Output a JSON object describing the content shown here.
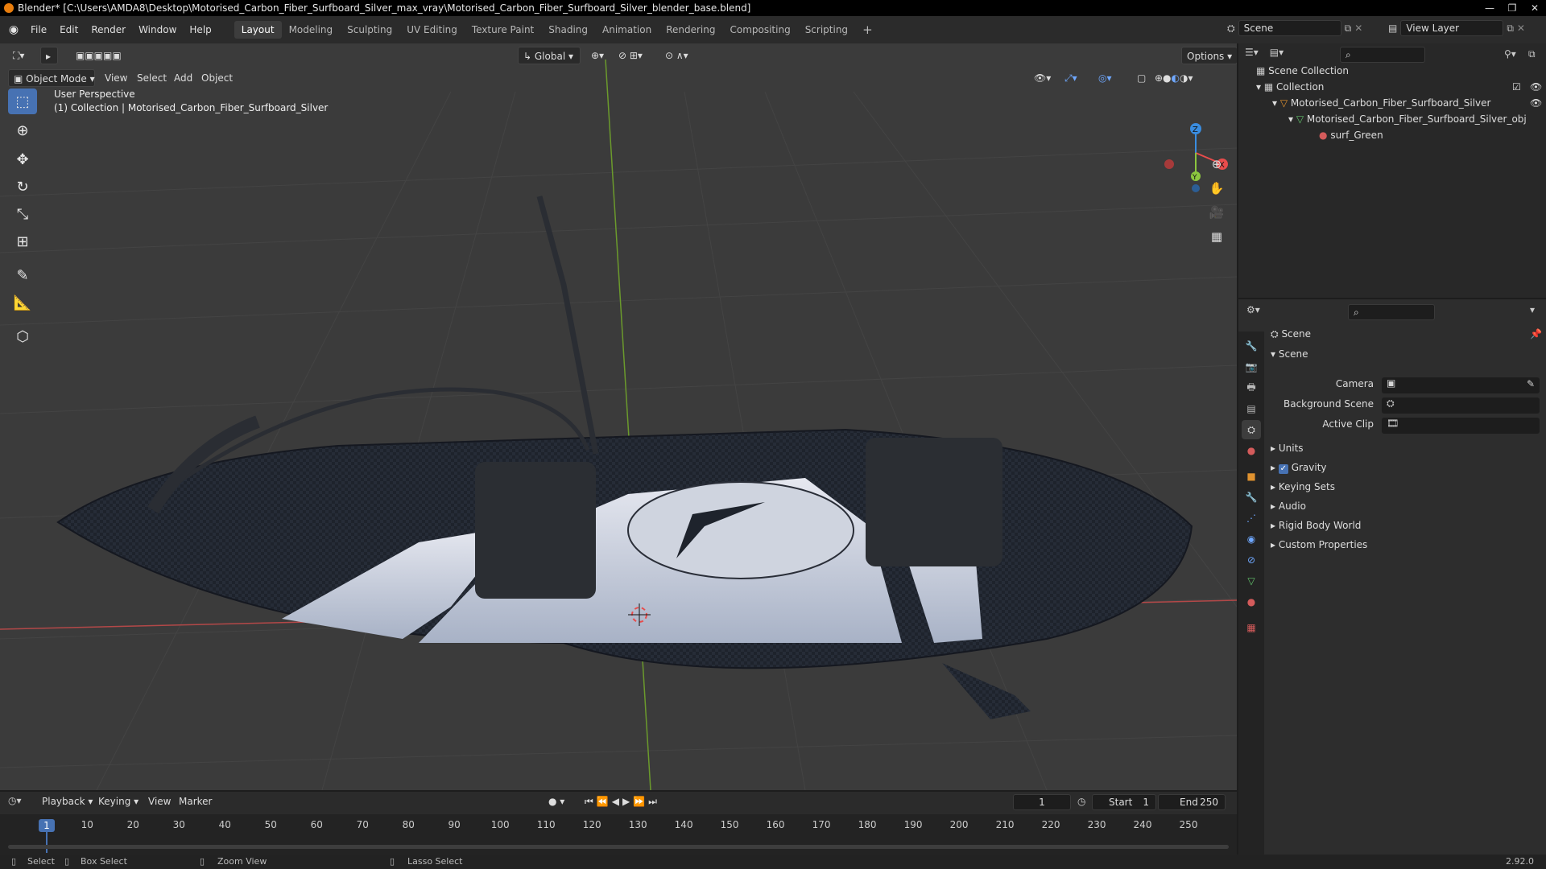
{
  "titlebar": {
    "title": "Blender* [C:\\Users\\AMDA8\\Desktop\\Motorised_Carbon_Fiber_Surfboard_Silver_max_vray\\Motorised_Carbon_Fiber_Surfboard_Silver_blender_base.blend]",
    "min": "—",
    "max": "❐",
    "close": "✕"
  },
  "menu": {
    "items": [
      "File",
      "Edit",
      "Render",
      "Window",
      "Help"
    ]
  },
  "workspaces": {
    "tabs": [
      "Layout",
      "Modeling",
      "Sculpting",
      "UV Editing",
      "Texture Paint",
      "Shading",
      "Animation",
      "Rendering",
      "Compositing",
      "Scripting"
    ],
    "active": "Layout",
    "add": "+"
  },
  "scene_selector": {
    "value": "Scene"
  },
  "view_layer_selector": {
    "value": "View Layer"
  },
  "viewport": {
    "mode": "Object Mode",
    "menus": [
      "View",
      "Select",
      "Add",
      "Object"
    ],
    "transform_orientation": "Global",
    "options": "Options",
    "perspective_label": "User Perspective",
    "collection_label": "(1) Collection | Motorised_Carbon_Fiber_Surfboard_Silver",
    "gizmo": {
      "x": "X",
      "y": "Y",
      "z": "Z"
    }
  },
  "outliner": {
    "root": "Scene Collection",
    "collection": "Collection",
    "object": "Motorised_Carbon_Fiber_Surfboard_Silver",
    "mesh": "Motorised_Carbon_Fiber_Surfboard_Silver_obj",
    "material": "surf_Green"
  },
  "properties": {
    "header": "Scene",
    "section": "Scene",
    "camera_label": "Camera",
    "background_scene_label": "Background Scene",
    "active_clip_label": "Active Clip",
    "panels": [
      "Units",
      "Gravity",
      "Keying Sets",
      "Audio",
      "Rigid Body World",
      "Custom Properties"
    ],
    "gravity_checked": true
  },
  "timeline": {
    "menus": [
      "Playback",
      "Keying",
      "View",
      "Marker"
    ],
    "current_frame": "1",
    "start_label": "Start",
    "start": "1",
    "end_label": "End",
    "end": "250",
    "ticks": [
      "1",
      "10",
      "20",
      "30",
      "40",
      "50",
      "60",
      "70",
      "80",
      "90",
      "100",
      "110",
      "120",
      "130",
      "140",
      "150",
      "160",
      "170",
      "180",
      "190",
      "200",
      "210",
      "220",
      "230",
      "240",
      "250"
    ]
  },
  "statusbar": {
    "select": "Select",
    "box_select": "Box Select",
    "zoom_view": "Zoom View",
    "lasso_select": "Lasso Select",
    "version": "2.92.0"
  },
  "colors": {
    "accent": "#4772b3",
    "brand": "#e87d0d",
    "x_axis": "#e84c4c",
    "y_axis": "#8cc63f",
    "z_axis": "#3a8de0"
  }
}
